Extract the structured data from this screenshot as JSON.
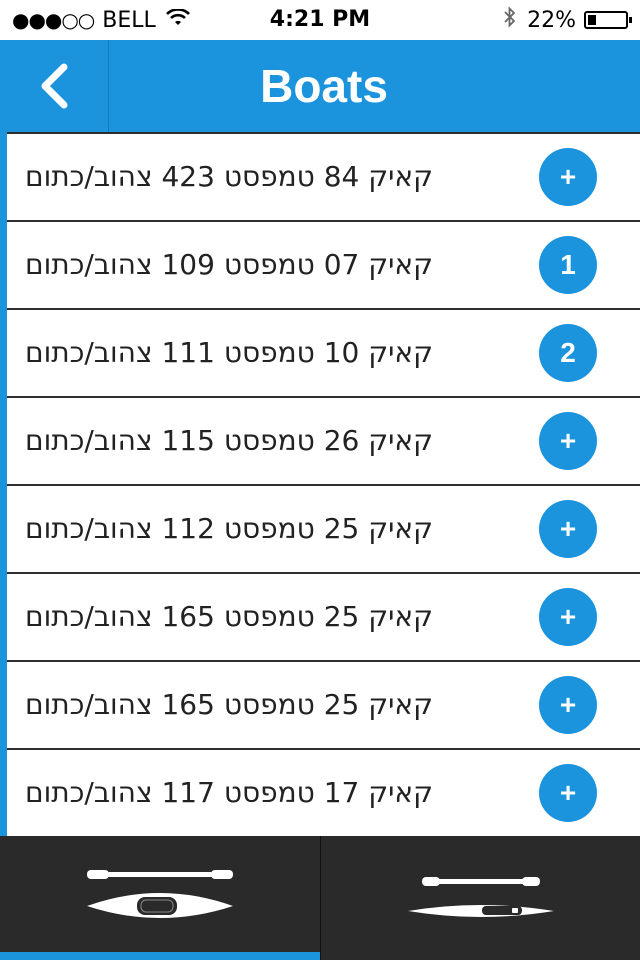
{
  "status_bar": {
    "signal": "●●●○○",
    "carrier": "BELL",
    "time": "4:21 PM",
    "battery_text": "22%",
    "battery_level": 0.22
  },
  "header": {
    "title": "Boats"
  },
  "boats": [
    {
      "label": "קאיק 84 טמפסט 423 צהוב/כתום",
      "action": "+"
    },
    {
      "label": "קאיק 07 טמפסט 109 צהוב/כתום",
      "action": "1"
    },
    {
      "label": "קאיק 10 טמפסט 111 צהוב/כתום",
      "action": "2"
    },
    {
      "label": "קאיק 26 טמפסט 115 צהוב/כתום",
      "action": "+"
    },
    {
      "label": "קאיק 25 טמפסט 112 צהוב/כתום",
      "action": "+"
    },
    {
      "label": "קאיק 25 טמפסט 165 צהוב/כתום",
      "action": "+"
    },
    {
      "label": "קאיק 25 טמפסט 165 צהוב/כתום",
      "action": "+"
    },
    {
      "label": "קאיק 17 טמפסט 117 צהוב/כתום",
      "action": "+"
    }
  ],
  "tabs": [
    {
      "icon": "kayak-icon",
      "selected": true
    },
    {
      "icon": "rowboat-icon",
      "selected": false
    }
  ],
  "colors": {
    "accent": "#1b93dd",
    "tabbar": "#2a2a2a"
  }
}
